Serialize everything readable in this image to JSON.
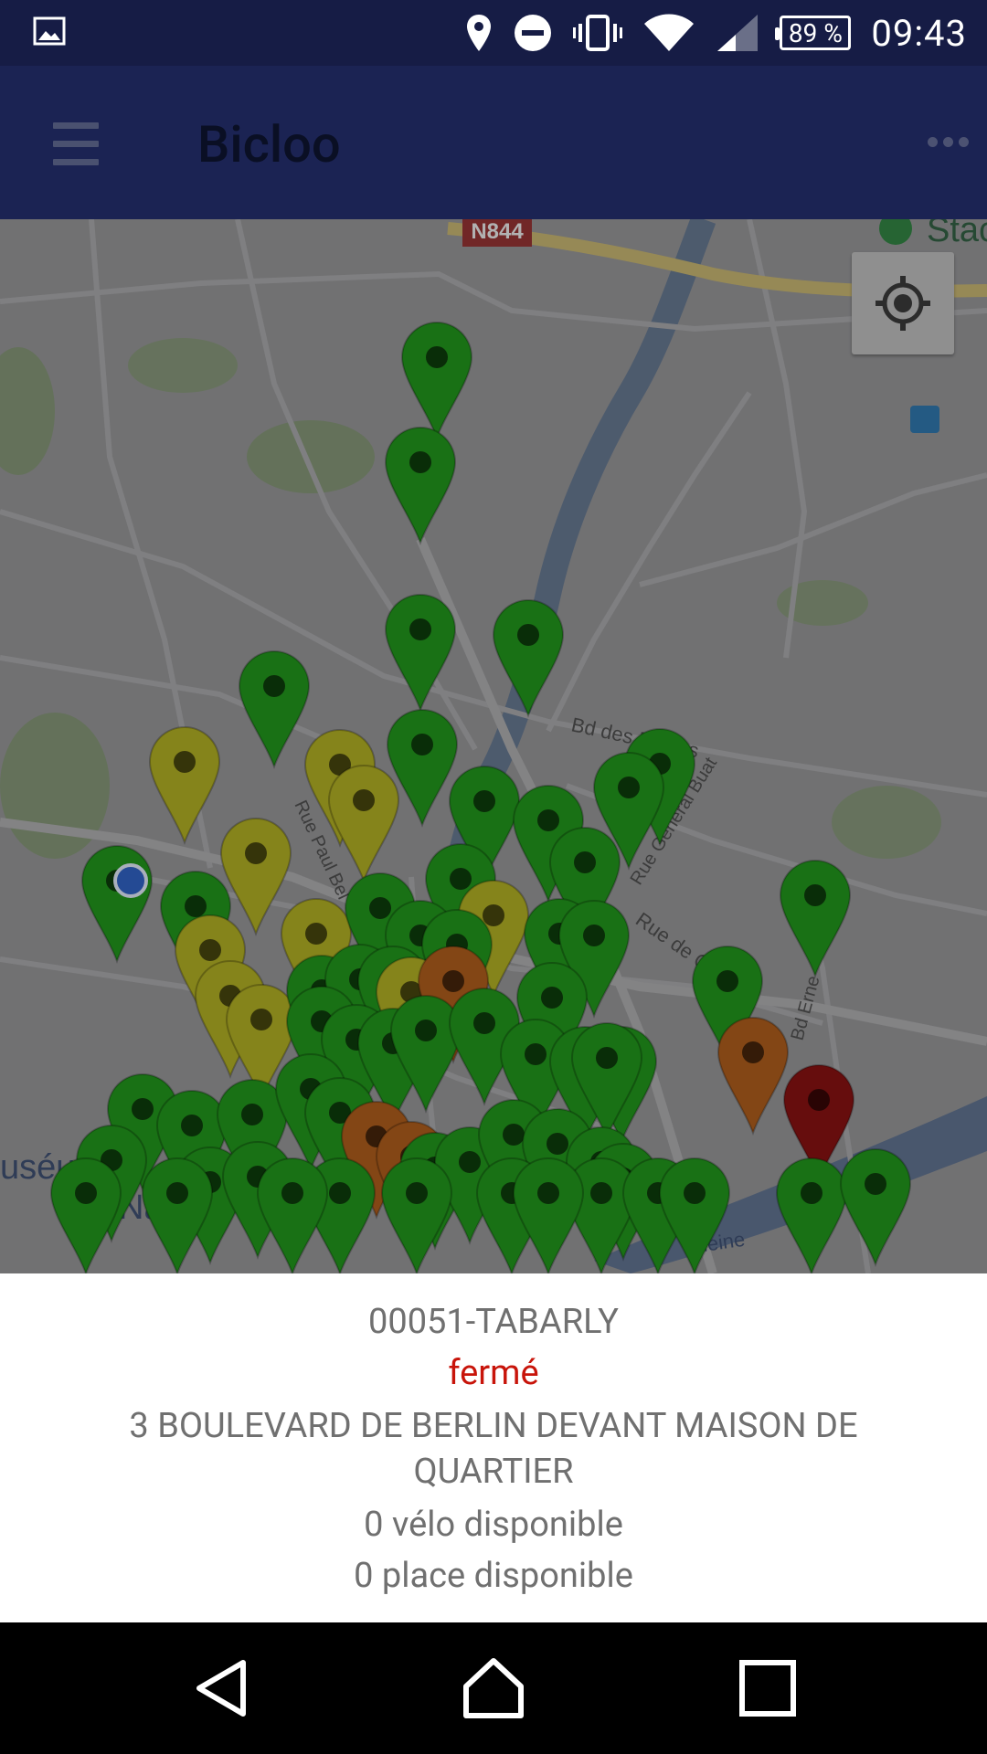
{
  "status_bar": {
    "battery": "89 %",
    "time": "09:43"
  },
  "app_bar": {
    "title": "Bicloo",
    "menu_icon": "hamburger-menu-icon",
    "overflow_icon": "more-horizontal-icon"
  },
  "map": {
    "road_label_1": "N844",
    "road_label_2": "Bd des Belges",
    "road_label_3": "Rue Paul Bel",
    "road_label_4": "Rue Général Buat",
    "road_label_5": "Rue de C",
    "road_label_6": "Bd Erne",
    "place_label_1": "Stac",
    "place_label_2": "uséum",
    "place_label_3": "Nat",
    "place_label_4": "leine",
    "my_location_icon": "my-location-icon",
    "marker_colors": {
      "green": "#1f8a1a",
      "yellow": "#a3a121",
      "orange": "#a0561a",
      "red": "#7d1010",
      "user": "#2c5bb5"
    }
  },
  "station_info": {
    "name": "00051-TABARLY",
    "status": "fermé",
    "address": "3 BOULEVARD DE BERLIN DEVANT MAISON DE QUARTIER",
    "bikes": "0 vélo disponible",
    "places": "0 place disponible"
  },
  "nav_bar": {
    "back_icon": "back-icon",
    "home_icon": "home-icon",
    "recents_icon": "recents-icon"
  }
}
